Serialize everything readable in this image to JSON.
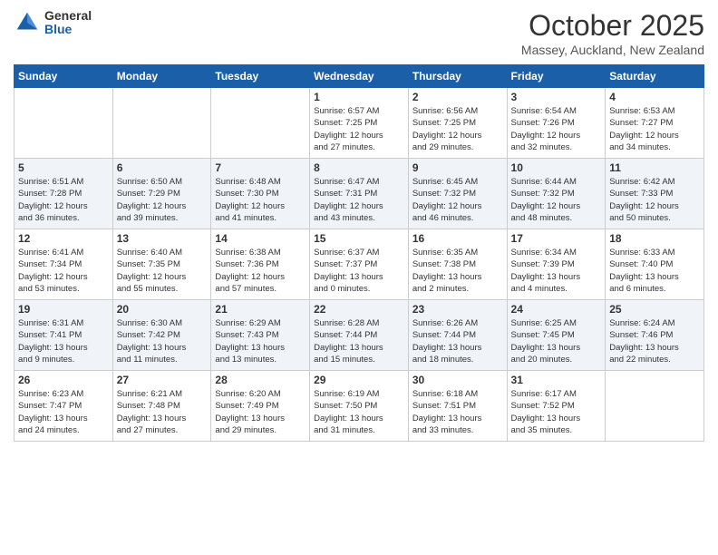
{
  "logo": {
    "general": "General",
    "blue": "Blue"
  },
  "title": "October 2025",
  "location": "Massey, Auckland, New Zealand",
  "weekdays": [
    "Sunday",
    "Monday",
    "Tuesday",
    "Wednesday",
    "Thursday",
    "Friday",
    "Saturday"
  ],
  "weeks": [
    [
      {
        "day": "",
        "info": ""
      },
      {
        "day": "",
        "info": ""
      },
      {
        "day": "",
        "info": ""
      },
      {
        "day": "1",
        "info": "Sunrise: 6:57 AM\nSunset: 7:25 PM\nDaylight: 12 hours\nand 27 minutes."
      },
      {
        "day": "2",
        "info": "Sunrise: 6:56 AM\nSunset: 7:25 PM\nDaylight: 12 hours\nand 29 minutes."
      },
      {
        "day": "3",
        "info": "Sunrise: 6:54 AM\nSunset: 7:26 PM\nDaylight: 12 hours\nand 32 minutes."
      },
      {
        "day": "4",
        "info": "Sunrise: 6:53 AM\nSunset: 7:27 PM\nDaylight: 12 hours\nand 34 minutes."
      }
    ],
    [
      {
        "day": "5",
        "info": "Sunrise: 6:51 AM\nSunset: 7:28 PM\nDaylight: 12 hours\nand 36 minutes."
      },
      {
        "day": "6",
        "info": "Sunrise: 6:50 AM\nSunset: 7:29 PM\nDaylight: 12 hours\nand 39 minutes."
      },
      {
        "day": "7",
        "info": "Sunrise: 6:48 AM\nSunset: 7:30 PM\nDaylight: 12 hours\nand 41 minutes."
      },
      {
        "day": "8",
        "info": "Sunrise: 6:47 AM\nSunset: 7:31 PM\nDaylight: 12 hours\nand 43 minutes."
      },
      {
        "day": "9",
        "info": "Sunrise: 6:45 AM\nSunset: 7:32 PM\nDaylight: 12 hours\nand 46 minutes."
      },
      {
        "day": "10",
        "info": "Sunrise: 6:44 AM\nSunset: 7:32 PM\nDaylight: 12 hours\nand 48 minutes."
      },
      {
        "day": "11",
        "info": "Sunrise: 6:42 AM\nSunset: 7:33 PM\nDaylight: 12 hours\nand 50 minutes."
      }
    ],
    [
      {
        "day": "12",
        "info": "Sunrise: 6:41 AM\nSunset: 7:34 PM\nDaylight: 12 hours\nand 53 minutes."
      },
      {
        "day": "13",
        "info": "Sunrise: 6:40 AM\nSunset: 7:35 PM\nDaylight: 12 hours\nand 55 minutes."
      },
      {
        "day": "14",
        "info": "Sunrise: 6:38 AM\nSunset: 7:36 PM\nDaylight: 12 hours\nand 57 minutes."
      },
      {
        "day": "15",
        "info": "Sunrise: 6:37 AM\nSunset: 7:37 PM\nDaylight: 13 hours\nand 0 minutes."
      },
      {
        "day": "16",
        "info": "Sunrise: 6:35 AM\nSunset: 7:38 PM\nDaylight: 13 hours\nand 2 minutes."
      },
      {
        "day": "17",
        "info": "Sunrise: 6:34 AM\nSunset: 7:39 PM\nDaylight: 13 hours\nand 4 minutes."
      },
      {
        "day": "18",
        "info": "Sunrise: 6:33 AM\nSunset: 7:40 PM\nDaylight: 13 hours\nand 6 minutes."
      }
    ],
    [
      {
        "day": "19",
        "info": "Sunrise: 6:31 AM\nSunset: 7:41 PM\nDaylight: 13 hours\nand 9 minutes."
      },
      {
        "day": "20",
        "info": "Sunrise: 6:30 AM\nSunset: 7:42 PM\nDaylight: 13 hours\nand 11 minutes."
      },
      {
        "day": "21",
        "info": "Sunrise: 6:29 AM\nSunset: 7:43 PM\nDaylight: 13 hours\nand 13 minutes."
      },
      {
        "day": "22",
        "info": "Sunrise: 6:28 AM\nSunset: 7:44 PM\nDaylight: 13 hours\nand 15 minutes."
      },
      {
        "day": "23",
        "info": "Sunrise: 6:26 AM\nSunset: 7:44 PM\nDaylight: 13 hours\nand 18 minutes."
      },
      {
        "day": "24",
        "info": "Sunrise: 6:25 AM\nSunset: 7:45 PM\nDaylight: 13 hours\nand 20 minutes."
      },
      {
        "day": "25",
        "info": "Sunrise: 6:24 AM\nSunset: 7:46 PM\nDaylight: 13 hours\nand 22 minutes."
      }
    ],
    [
      {
        "day": "26",
        "info": "Sunrise: 6:23 AM\nSunset: 7:47 PM\nDaylight: 13 hours\nand 24 minutes."
      },
      {
        "day": "27",
        "info": "Sunrise: 6:21 AM\nSunset: 7:48 PM\nDaylight: 13 hours\nand 27 minutes."
      },
      {
        "day": "28",
        "info": "Sunrise: 6:20 AM\nSunset: 7:49 PM\nDaylight: 13 hours\nand 29 minutes."
      },
      {
        "day": "29",
        "info": "Sunrise: 6:19 AM\nSunset: 7:50 PM\nDaylight: 13 hours\nand 31 minutes."
      },
      {
        "day": "30",
        "info": "Sunrise: 6:18 AM\nSunset: 7:51 PM\nDaylight: 13 hours\nand 33 minutes."
      },
      {
        "day": "31",
        "info": "Sunrise: 6:17 AM\nSunset: 7:52 PM\nDaylight: 13 hours\nand 35 minutes."
      },
      {
        "day": "",
        "info": ""
      }
    ]
  ]
}
